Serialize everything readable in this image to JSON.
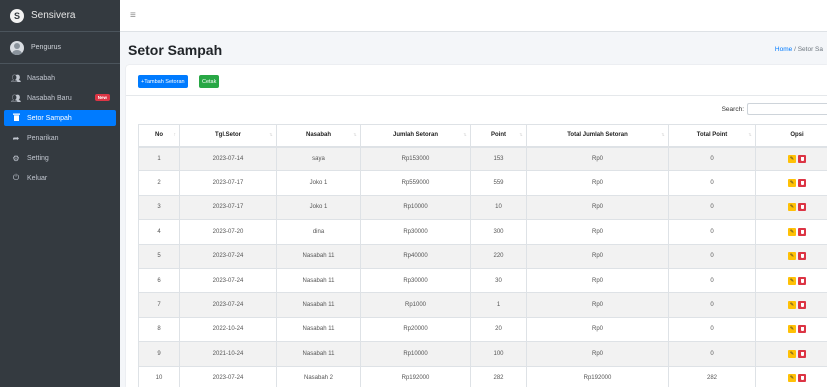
{
  "sidebar": {
    "brand": "Sensivera",
    "brand_logo_letter": "S",
    "user": "Pengurus",
    "items": [
      {
        "label": "Nasabah",
        "icon": "users-icon"
      },
      {
        "label": "Nasabah Baru",
        "icon": "users-icon",
        "badge": "New"
      },
      {
        "label": "Setor Sampah",
        "icon": "trash-icon",
        "active": true
      },
      {
        "label": "Penarikan",
        "icon": "share-icon"
      },
      {
        "label": "Setting",
        "icon": "cogs-icon"
      },
      {
        "label": "Keluar",
        "icon": "power-icon"
      }
    ]
  },
  "topbar": {
    "menu_icon": "hamburger-icon"
  },
  "page": {
    "title": "Setor Sampah",
    "breadcrumb": {
      "home": "Home",
      "separator": "/",
      "current": "Setor Sa"
    }
  },
  "toolbar": {
    "add_label": "+Tambah Setoran",
    "print_label": "Cetak"
  },
  "search": {
    "label": "Search:",
    "value": ""
  },
  "table": {
    "columns": [
      "No",
      "Tgl.Setor",
      "Nasabah",
      "Jumlah Setoran",
      "Point",
      "Total Jumlah Setoran",
      "Total Point",
      "Opsi"
    ],
    "rows": [
      {
        "no": "1",
        "tgl": "2023-07-14",
        "nasabah": "saya",
        "jumlah": "Rp153000",
        "point": "153",
        "total_jumlah": "Rp0",
        "total_point": "0"
      },
      {
        "no": "2",
        "tgl": "2023-07-17",
        "nasabah": "Joko 1",
        "jumlah": "Rp559000",
        "point": "559",
        "total_jumlah": "Rp0",
        "total_point": "0"
      },
      {
        "no": "3",
        "tgl": "2023-07-17",
        "nasabah": "Joko 1",
        "jumlah": "Rp10000",
        "point": "10",
        "total_jumlah": "Rp0",
        "total_point": "0"
      },
      {
        "no": "4",
        "tgl": "2023-07-20",
        "nasabah": "dina",
        "jumlah": "Rp30000",
        "point": "300",
        "total_jumlah": "Rp0",
        "total_point": "0"
      },
      {
        "no": "5",
        "tgl": "2023-07-24",
        "nasabah": "Nasabah 11",
        "jumlah": "Rp40000",
        "point": "220",
        "total_jumlah": "Rp0",
        "total_point": "0"
      },
      {
        "no": "6",
        "tgl": "2023-07-24",
        "nasabah": "Nasabah 11",
        "jumlah": "Rp30000",
        "point": "30",
        "total_jumlah": "Rp0",
        "total_point": "0"
      },
      {
        "no": "7",
        "tgl": "2023-07-24",
        "nasabah": "Nasabah 11",
        "jumlah": "Rp1000",
        "point": "1",
        "total_jumlah": "Rp0",
        "total_point": "0"
      },
      {
        "no": "8",
        "tgl": "2022-10-24",
        "nasabah": "Nasabah 11",
        "jumlah": "Rp20000",
        "point": "20",
        "total_jumlah": "Rp0",
        "total_point": "0"
      },
      {
        "no": "9",
        "tgl": "2021-10-24",
        "nasabah": "Nasabah 11",
        "jumlah": "Rp10000",
        "point": "100",
        "total_jumlah": "Rp0",
        "total_point": "0"
      },
      {
        "no": "10",
        "tgl": "2023-07-24",
        "nasabah": "Nasabah 2",
        "jumlah": "Rp192000",
        "point": "282",
        "total_jumlah": "Rp192000",
        "total_point": "282"
      }
    ]
  },
  "colors": {
    "sidebar": "#343a40",
    "primary": "#007bff",
    "success": "#28a745",
    "warning": "#ffc107",
    "danger": "#dc3545"
  }
}
